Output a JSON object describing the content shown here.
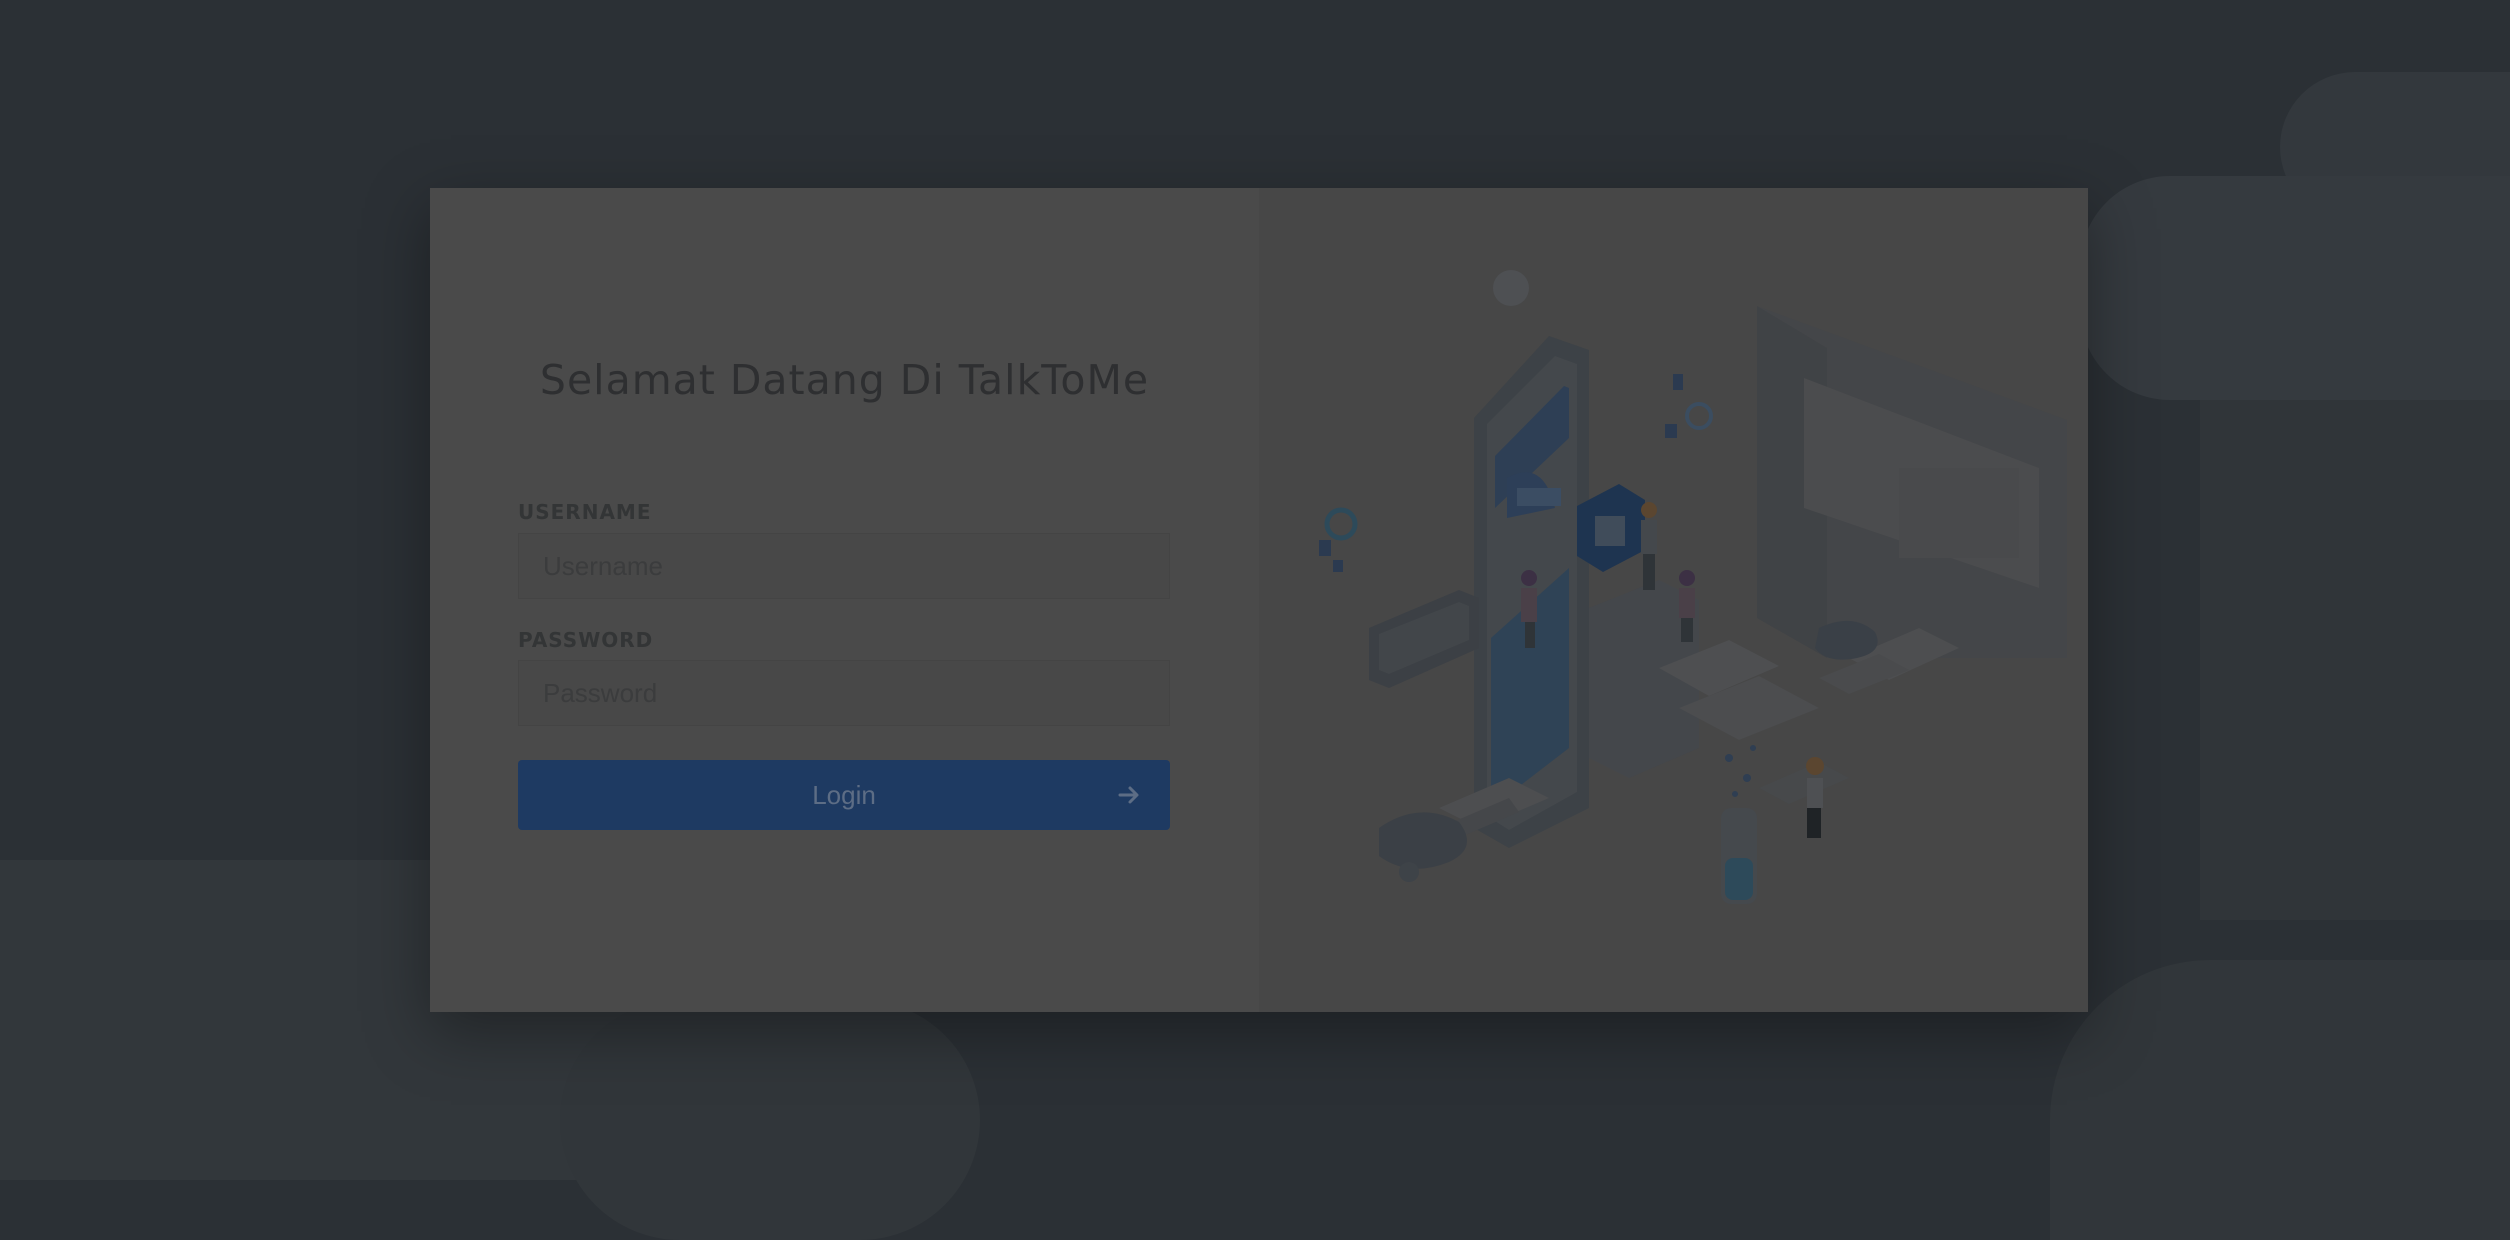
{
  "page": {
    "title": "Selamat Datang Di TalkToMe"
  },
  "form": {
    "username_label": "USERNAME",
    "username_placeholder": "Username",
    "username_value": "",
    "password_label": "PASSWORD",
    "password_placeholder": "Password",
    "password_value": "",
    "login_label": "Login"
  },
  "icons": {
    "login_arrow": "arrow-right-icon",
    "illustration": "isometric-mobile-app-illustration"
  },
  "colors": {
    "overlay": "#2b3035",
    "card": "#4a4a4a",
    "primary": "#1e3a62"
  }
}
